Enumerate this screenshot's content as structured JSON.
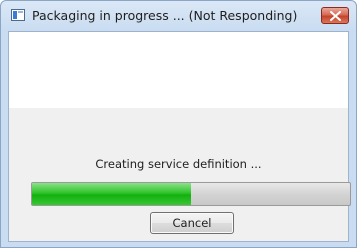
{
  "window": {
    "title": "Packaging in progress ... (Not Responding)"
  },
  "status": {
    "message": "Creating service definition ..."
  },
  "progress": {
    "fraction": 0.5
  },
  "buttons": {
    "cancel_label": "Cancel"
  },
  "icons": {
    "app": "window-app-icon",
    "close": "close-icon"
  },
  "colors": {
    "progress_fill": "#14b010",
    "close_button": "#c4442b"
  }
}
